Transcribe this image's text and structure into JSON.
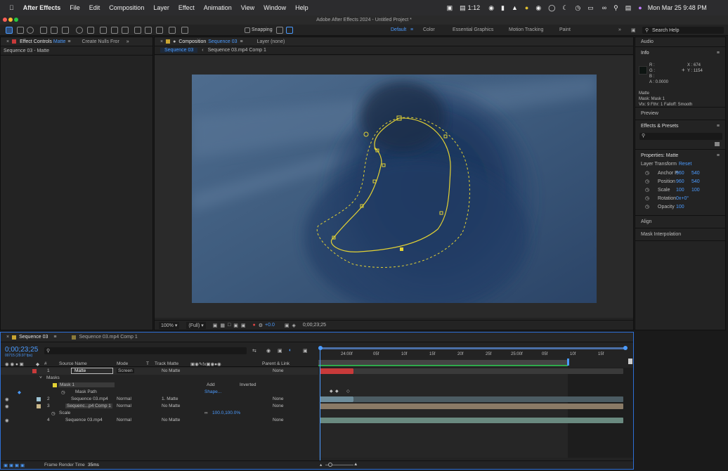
{
  "menubar": {
    "app": "After Effects",
    "items": [
      "File",
      "Edit",
      "Composition",
      "Layer",
      "Effect",
      "Animation",
      "View",
      "Window",
      "Help"
    ],
    "timer": "1:12",
    "clock": "Mon Mar 25  9:48 PM"
  },
  "window_title": "Adobe After Effects 2024 - Untitled Project *",
  "toolbar": {
    "snapping": "Snapping",
    "workspaces": [
      "Default",
      "Color",
      "Essential Graphics",
      "Motion Tracking",
      "Paint"
    ],
    "search_placeholder": "Search Help"
  },
  "left_panel": {
    "tab_effect": "Effect Controls",
    "tab_effect_layer": "Matte",
    "tab_nulls": "Create Nulls Fror",
    "header": "Sequence 03 - Matte"
  },
  "comp_panel": {
    "tab_label": "Composition",
    "tab_name": "Sequence 03",
    "layer_tab": "Layer (none)",
    "sub_tabs": [
      "Sequence 03",
      "Sequence 03.mp4 Comp 1"
    ],
    "zoom": "100%",
    "resolution": "(Full)",
    "exposure": "+0.0",
    "timecode": "0;00;23;25"
  },
  "right_panel": {
    "audio": "Audio",
    "info": {
      "title": "Info",
      "r": "R :",
      "g": "G :",
      "b": "B :",
      "a": "A :  0.0000",
      "x": "X : 674",
      "y": "Y : 1154",
      "layer": "Matte",
      "mask": "Mask: Mask 1",
      "detail": "Vtx: 9 Fthr: 1 Falloff: Smooth"
    },
    "preview": "Preview",
    "effects_presets": "Effects & Presets",
    "properties": {
      "title": "Properties: Matte",
      "layer_transform": "Layer Transform",
      "reset": "Reset",
      "rows": [
        {
          "label": "Anchor P.",
          "v1": "960",
          "v2": "540"
        },
        {
          "label": "Position",
          "v1": "960",
          "v2": "540"
        },
        {
          "label": "Scale",
          "v1": "100",
          "v2": "100"
        },
        {
          "label": "Rotation",
          "v1": "0x+0°",
          "v2": ""
        },
        {
          "label": "Opacity",
          "v1": "100",
          "v2": ""
        }
      ]
    },
    "align": "Align",
    "mask_interp": "Mask Interpolation"
  },
  "timeline": {
    "tabs": [
      "Sequence 03",
      "Sequence 03.mp4 Comp 1"
    ],
    "timecode": "0;00;23;25",
    "fps": "00715 (29.97 fps)",
    "headers": {
      "source": "Source Name",
      "mode": "Mode",
      "t": "T",
      "track": "Track Matte",
      "parent": "Parent & Link"
    },
    "ruler": [
      "24:00f",
      "05f",
      "10f",
      "15f",
      "20f",
      "25f",
      "25:00f",
      "05f",
      "10f",
      "15f"
    ],
    "layers": [
      {
        "num": "1",
        "name": "Matte",
        "mode": "Screen",
        "track": "No Matte",
        "parent": "None"
      },
      {
        "label": "Masks"
      },
      {
        "label": "Mask 1",
        "mode": "Add",
        "inv": "Inverted"
      },
      {
        "label": "Mask Path",
        "shape": "Shape..."
      },
      {
        "num": "2",
        "name": "Sequence 03.mp4",
        "mode": "Normal",
        "track": "1. Matte",
        "parent": "None"
      },
      {
        "num": "3",
        "name": "Sequenc...p4 Comp 1",
        "mode": "Normal",
        "track": "No Matte",
        "parent": "None"
      },
      {
        "label": "Scale",
        "value": "100.0,100.0%"
      },
      {
        "num": "4",
        "name": "Sequence 03.mp4",
        "mode": "Normal",
        "track": "No Matte",
        "parent": "None"
      }
    ],
    "footer_label": "Frame Render Time",
    "footer_value": "35ms"
  },
  "colors": {
    "accent": "#4b9bff",
    "mask": "#e3d234",
    "red_label": "#c83a3a"
  }
}
